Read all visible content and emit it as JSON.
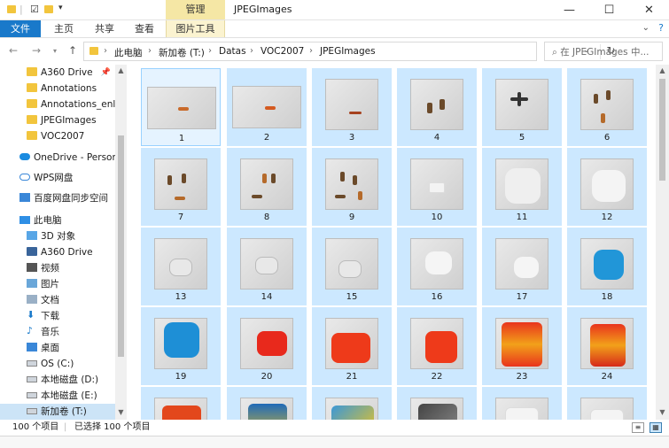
{
  "window": {
    "title": "JPEGImages",
    "context_tab": "管理",
    "controls": {
      "minimize": "—",
      "maximize": "☐",
      "close": "✕"
    }
  },
  "ribbon": {
    "tabs": [
      {
        "label": "文件"
      },
      {
        "label": "主页"
      },
      {
        "label": "共享"
      },
      {
        "label": "查看"
      },
      {
        "label": "图片工具"
      }
    ]
  },
  "address": {
    "crumbs": [
      "此电脑",
      "新加卷 (T:)",
      "Datas",
      "VOC2007",
      "JPEGImages"
    ],
    "search_placeholder": "在 JPEGImages 中..."
  },
  "nav": {
    "items": [
      {
        "label": "A360 Drive",
        "icon": "folder-icon"
      },
      {
        "label": "Annotations",
        "icon": "folder-icon"
      },
      {
        "label": "Annotations_enl",
        "icon": "folder-icon"
      },
      {
        "label": "JPEGImages",
        "icon": "folder-icon"
      },
      {
        "label": "VOC2007",
        "icon": "folder-icon"
      },
      {
        "label": "OneDrive - Person",
        "icon": "onedrive-icon"
      },
      {
        "label": "WPS网盘",
        "icon": "cloud-icon"
      },
      {
        "label": "百度网盘同步空间",
        "icon": "baidu-icon"
      },
      {
        "label": "此电脑",
        "icon": "pc-icon"
      },
      {
        "label": "3D 对象",
        "icon": "3d-objects-icon"
      },
      {
        "label": "A360 Drive",
        "icon": "folder-icon"
      },
      {
        "label": "视频",
        "icon": "video-icon"
      },
      {
        "label": "图片",
        "icon": "pictures-icon"
      },
      {
        "label": "文档",
        "icon": "documents-icon"
      },
      {
        "label": "下载",
        "icon": "download-icon"
      },
      {
        "label": "音乐",
        "icon": "music-icon"
      },
      {
        "label": "桌面",
        "icon": "desktop-icon"
      },
      {
        "label": "OS (C:)",
        "icon": "drive-icon"
      },
      {
        "label": "本地磁盘 (D:)",
        "icon": "drive-icon"
      },
      {
        "label": "本地磁盘 (E:)",
        "icon": "drive-icon"
      },
      {
        "label": "新加卷 (T:)",
        "icon": "drive-icon"
      }
    ]
  },
  "files": [
    {
      "label": "1"
    },
    {
      "label": "2"
    },
    {
      "label": "3"
    },
    {
      "label": "4"
    },
    {
      "label": "5"
    },
    {
      "label": "6"
    },
    {
      "label": "7"
    },
    {
      "label": "8"
    },
    {
      "label": "9"
    },
    {
      "label": "10"
    },
    {
      "label": "11"
    },
    {
      "label": "12"
    },
    {
      "label": "13"
    },
    {
      "label": "14"
    },
    {
      "label": "15"
    },
    {
      "label": "16"
    },
    {
      "label": "17"
    },
    {
      "label": "18"
    },
    {
      "label": "19"
    },
    {
      "label": "20"
    },
    {
      "label": "21"
    },
    {
      "label": "22"
    },
    {
      "label": "23"
    },
    {
      "label": "24"
    },
    {
      "label": ""
    },
    {
      "label": ""
    },
    {
      "label": ""
    },
    {
      "label": ""
    },
    {
      "label": ""
    },
    {
      "label": ""
    }
  ],
  "status": {
    "count": "100 个项目",
    "selected": "已选择 100 个项目"
  },
  "colors": {
    "accent": "#1979ca",
    "selection": "#cce8ff",
    "context_tab": "#f5e7a5"
  }
}
